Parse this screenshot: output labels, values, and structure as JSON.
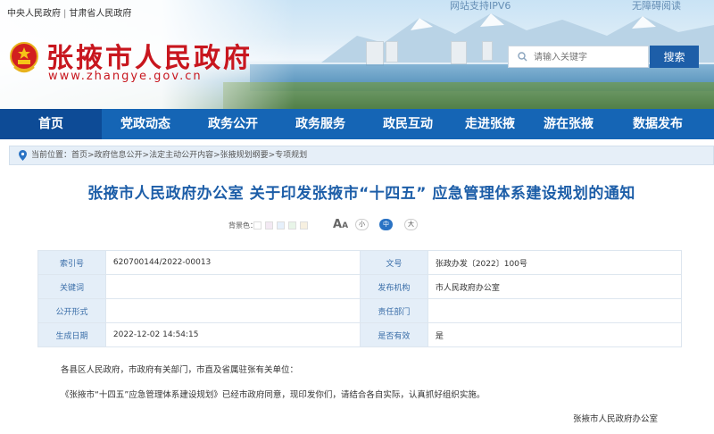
{
  "header": {
    "top_links": [
      "中央人民政府",
      "甘肃省人民政府"
    ],
    "ipv6": "网站支持IPV6",
    "accessible": "无障碍阅读",
    "site_title": "张掖市人民政府",
    "site_url": "www.zhangye.gov.cn",
    "search_placeholder": "请输入关键字",
    "search_button": "搜索"
  },
  "nav": [
    "首页",
    "党政动态",
    "政务公开",
    "政务服务",
    "政民互动",
    "走进张掖",
    "游在张掖",
    "数据发布"
  ],
  "breadcrumb": "当前位置：首页>政府信息公开>法定主动公开内容>张掖规划纲要>专项规划",
  "article": {
    "title": "张掖市人民政府办公室 关于印发张掖市“十四五” 应急管理体系建设规划的通知",
    "bg_label": "背景色：",
    "bg_colors": [
      "#ffffff",
      "#f3e9f3",
      "#e6f0fb",
      "#e8f5e8",
      "#f7f0e0"
    ],
    "font_sizes": [
      "小",
      "中",
      "大"
    ],
    "meta": [
      {
        "label": "索引号",
        "value": "620700144/2022-00013",
        "label2": "文号",
        "value2": "张政办发〔2022〕100号"
      },
      {
        "label": "关键词",
        "value": "",
        "label2": "发布机构",
        "value2": "市人民政府办公室"
      },
      {
        "label": "公开形式",
        "value": "",
        "label2": "责任部门",
        "value2": ""
      },
      {
        "label": "生成日期",
        "value": "2022-12-02 14:54:15",
        "label2": "是否有效",
        "value2": "是"
      }
    ],
    "salutation": "各县区人民政府，市政府有关部门，市直及省属驻张有关单位：",
    "body": "《张掖市“十四五”应急管理体系建设规划》已经市政府同意，现印发你们，请结合各自实际，认真抓好组织实施。",
    "signature": "张掖市人民政府办公室"
  }
}
